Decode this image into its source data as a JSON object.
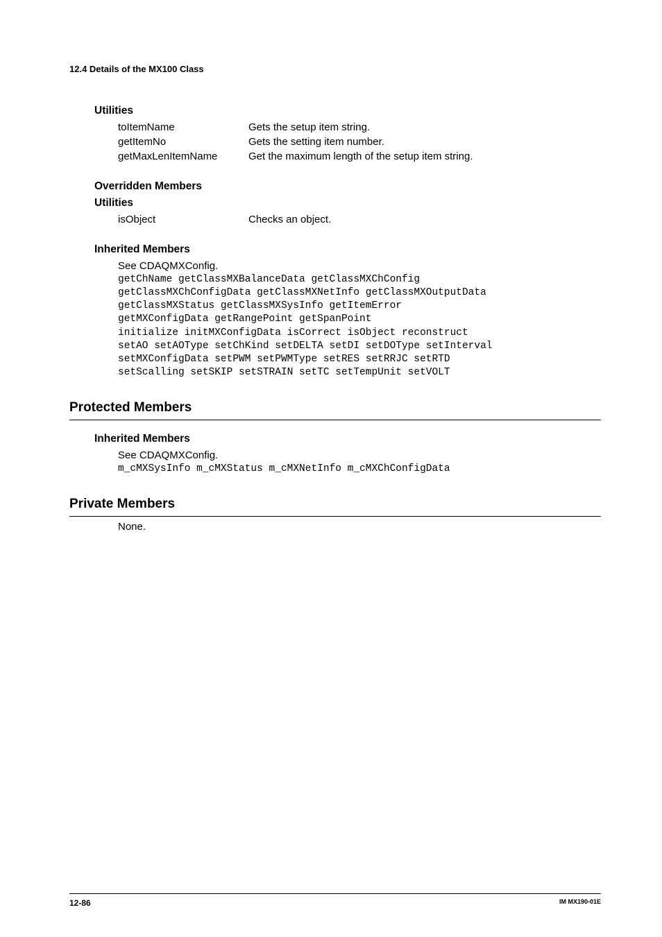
{
  "header": {
    "section_number": "12.4  Details of the MX100 Class"
  },
  "utilities1": {
    "heading": "Utilities",
    "items": [
      {
        "name": "toItemName",
        "desc": "Gets the setup item string."
      },
      {
        "name": "getItemNo",
        "desc": "Gets the setting item number."
      },
      {
        "name": "getMaxLenItemName",
        "desc": "Get the maximum length of the setup item string."
      }
    ]
  },
  "overridden": {
    "heading": "Overridden Members",
    "sub_heading": "Utilities",
    "items": [
      {
        "name": "isObject",
        "desc": "Checks an object."
      }
    ]
  },
  "inherited1": {
    "heading": "Inherited Members",
    "see_text": "See CDAQMXConfig.",
    "code": "getChName getClassMXBalanceData getClassMXChConfig\ngetClassMXChConfigData getClassMXNetInfo getClassMXOutputData\ngetClassMXStatus getClassMXSysInfo getItemError\ngetMXConfigData getRangePoint getSpanPoint\ninitialize initMXConfigData isCorrect isObject reconstruct\nsetAO setAOType setChKind setDELTA setDI setDOType setInterval\nsetMXConfigData setPWM setPWMType setRES setRRJC setRTD\nsetScalling setSKIP setSTRAIN setTC setTempUnit setVOLT"
  },
  "protected": {
    "heading": "Protected Members",
    "sub_heading": "Inherited Members",
    "see_text": "See CDAQMXConfig.",
    "code": "m_cMXSysInfo m_cMXStatus m_cMXNetInfo m_cMXChConfigData"
  },
  "private": {
    "heading": "Private Members",
    "text": "None."
  },
  "footer": {
    "page": "12-86",
    "doc": "IM MX190-01E"
  }
}
